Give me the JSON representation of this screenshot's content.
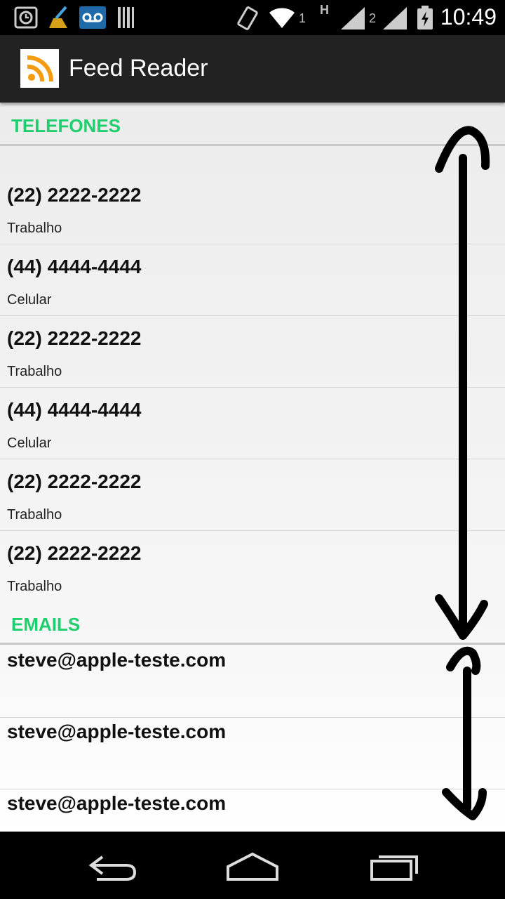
{
  "status_bar": {
    "time": "10:49",
    "signal_1_label": "1",
    "signal_2_label": "2",
    "network_type": "H",
    "icons": [
      "alarm-icon",
      "cleaner-icon",
      "voicemail-icon",
      "barcode-icon",
      "rotate-icon",
      "wifi-icon",
      "signal-icon",
      "battery-charging-icon"
    ]
  },
  "action_bar": {
    "title": "Feed Reader",
    "app_icon": "rss-feed-icon"
  },
  "sections": {
    "phones": {
      "header": "TELEFONES",
      "items": [
        {
          "number": "(22) 2222-2222",
          "type": "Trabalho"
        },
        {
          "number": "(44) 4444-4444",
          "type": "Celular"
        },
        {
          "number": "(22) 2222-2222",
          "type": "Trabalho"
        },
        {
          "number": "(44) 4444-4444",
          "type": "Celular"
        },
        {
          "number": "(22) 2222-2222",
          "type": "Trabalho"
        },
        {
          "number": "(22) 2222-2222",
          "type": "Trabalho"
        }
      ]
    },
    "emails": {
      "header": "EMAILS",
      "items": [
        {
          "address": "steve@apple-teste.com"
        },
        {
          "address": "steve@apple-teste.com"
        },
        {
          "address": "steve@apple-teste.com"
        }
      ]
    }
  },
  "nav_bar": {
    "buttons": [
      "back-icon",
      "home-icon",
      "recent-apps-icon"
    ]
  },
  "colors": {
    "section_header": "#1fcf6e",
    "action_bar": "#222222",
    "rss_orange": "#f39c12"
  }
}
